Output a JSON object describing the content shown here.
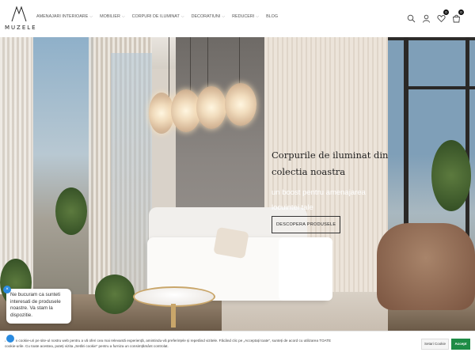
{
  "header": {
    "logo_text": "MUZELE",
    "nav": [
      {
        "label": "Amenajari interioare",
        "has_dropdown": true
      },
      {
        "label": "Mobilier",
        "has_dropdown": true
      },
      {
        "label": "Corpuri de iluminat",
        "has_dropdown": true
      },
      {
        "label": "Decoratiuni",
        "has_dropdown": true
      },
      {
        "label": "Reduceri",
        "has_dropdown": true
      },
      {
        "label": "Blog",
        "has_dropdown": false
      }
    ],
    "icons": [
      "search-icon",
      "user-icon",
      "heart-icon",
      "cart-icon"
    ],
    "wishlist_count": "0",
    "cart_count": "0"
  },
  "hero": {
    "title": "Corpurile de iluminat din colectia noastra",
    "subtitle": "un boost pentru amenajarea locuintei tale",
    "button_label": "Descopera produsele"
  },
  "chat": {
    "message": "Ne bucuram ca sunteti interesati de produsele noastre. Va stam la dispozitie."
  },
  "cookie": {
    "text": "Folosim cookie-uri pe site-ul nostru web pentru a vă oferi cea mai relevantă experiență, amintindu-vă preferințele și repetând vizitele. Făcând clic pe „Acceptați toate”, sunteți de acord cu utilizarea TOATE cookie-urile. Cu toate acestea, puteți vizita „Setări cookie” pentru a furniza un consimțământ controlat.",
    "settings_label": "Setari Cookie",
    "accept_label": "Accept"
  },
  "colors": {
    "accent_green": "#1e8c46",
    "chat_blue": "#2a8be0"
  }
}
